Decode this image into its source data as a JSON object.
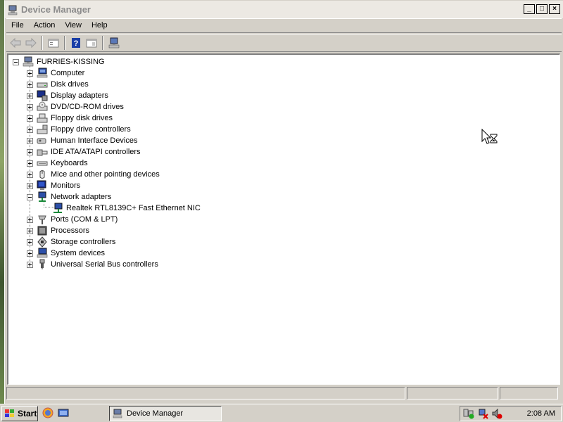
{
  "window": {
    "title": "Device Manager",
    "controls": {
      "minimize": "_",
      "maximize": "□",
      "close": "×"
    }
  },
  "menu": [
    {
      "label": "File"
    },
    {
      "label": "Action"
    },
    {
      "label": "View"
    },
    {
      "label": "Help"
    }
  ],
  "toolbar": {
    "buttons": [
      "back-arrow-icon",
      "forward-arrow-icon",
      "properties-icon",
      "help-icon",
      "view-icon",
      "scan-hardware-icon"
    ]
  },
  "tree": {
    "root": {
      "label": "FURRIES-KISSING",
      "icon": "computer-icon",
      "expanded": true
    },
    "categories": [
      {
        "label": "Computer",
        "icon": "computer-icon",
        "expanded": false
      },
      {
        "label": "Disk drives",
        "icon": "disk-drive-icon",
        "expanded": false
      },
      {
        "label": "Display adapters",
        "icon": "display-adapter-icon",
        "expanded": false
      },
      {
        "label": "DVD/CD-ROM drives",
        "icon": "cdrom-icon",
        "expanded": false
      },
      {
        "label": "Floppy disk drives",
        "icon": "floppy-icon",
        "expanded": false
      },
      {
        "label": "Floppy drive controllers",
        "icon": "floppy-controller-icon",
        "expanded": false
      },
      {
        "label": "Human Interface Devices",
        "icon": "hid-icon",
        "expanded": false
      },
      {
        "label": "IDE ATA/ATAPI controllers",
        "icon": "ide-controller-icon",
        "expanded": false
      },
      {
        "label": "Keyboards",
        "icon": "keyboard-icon",
        "expanded": false
      },
      {
        "label": "Mice and other pointing devices",
        "icon": "mouse-icon",
        "expanded": false
      },
      {
        "label": "Monitors",
        "icon": "monitor-icon",
        "expanded": false
      },
      {
        "label": "Network adapters",
        "icon": "network-adapter-icon",
        "expanded": true,
        "children": [
          {
            "label": "Realtek RTL8139C+ Fast Ethernet NIC",
            "icon": "network-card-icon"
          }
        ]
      },
      {
        "label": "Ports (COM & LPT)",
        "icon": "port-icon",
        "expanded": false
      },
      {
        "label": "Processors",
        "icon": "processor-icon",
        "expanded": false
      },
      {
        "label": "Storage controllers",
        "icon": "storage-controller-icon",
        "expanded": false
      },
      {
        "label": "System devices",
        "icon": "system-device-icon",
        "expanded": false
      },
      {
        "label": "Universal Serial Bus controllers",
        "icon": "usb-icon",
        "expanded": false
      }
    ]
  },
  "taskbar": {
    "start_label": "Start",
    "task_label": "Device Manager",
    "clock": "2:08 AM"
  },
  "colors": {
    "window_bg": "#d4d0c8",
    "tree_bg": "#ffffff",
    "title_text": "#8c8c8c",
    "accent_blue": "#1a3ea6"
  }
}
